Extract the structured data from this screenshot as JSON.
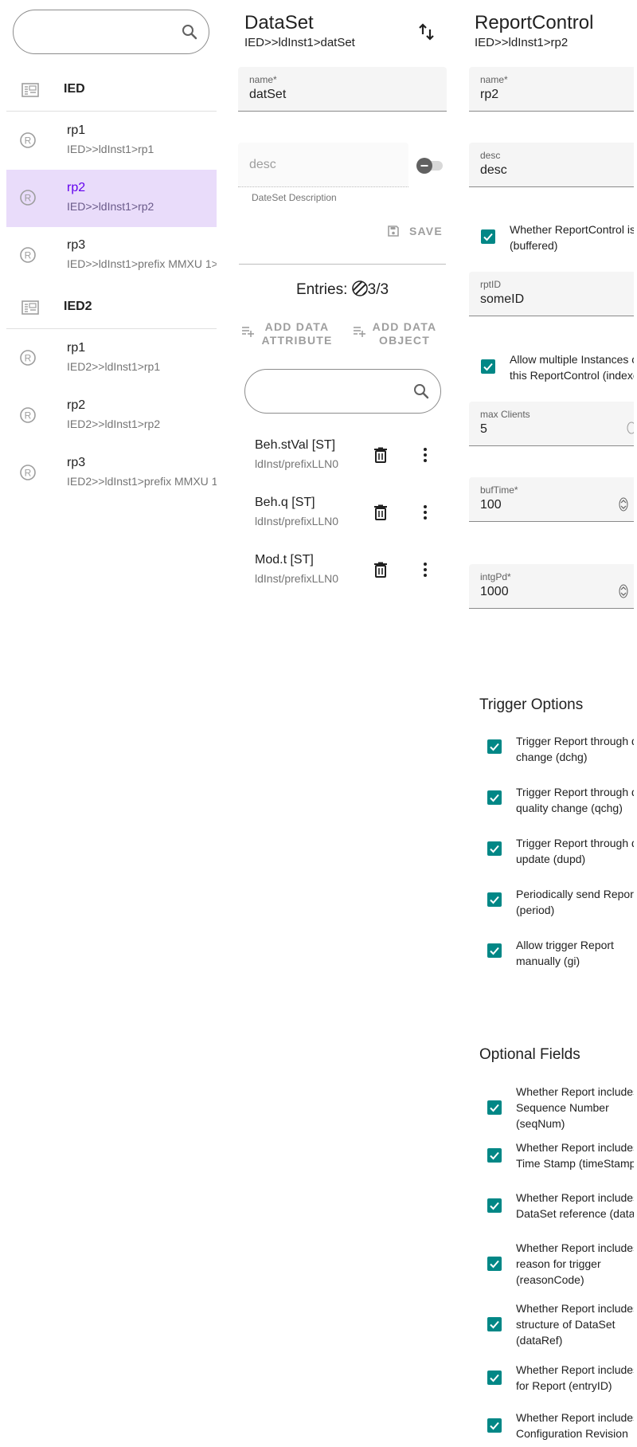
{
  "sidebar": {
    "search": {
      "placeholder": ""
    },
    "ieds": [
      {
        "name": "IED",
        "reports": [
          {
            "title": "rp1",
            "path": "IED>>ldInst1>rp1"
          },
          {
            "title": "rp2",
            "path": "IED>>ldInst1>rp2",
            "selected": true
          },
          {
            "title": "rp3",
            "path": "IED>>ldInst1>prefix MMXU 1>"
          }
        ]
      },
      {
        "name": "IED2",
        "reports": [
          {
            "title": "rp1",
            "path": "IED2>>ldInst1>rp1"
          },
          {
            "title": "rp2",
            "path": "IED2>>ldInst1>rp2"
          },
          {
            "title": "rp3",
            "path": "IED2>>ldInst1>prefix MMXU 1"
          }
        ]
      }
    ]
  },
  "dataset": {
    "title": "DataSet",
    "path": "IED>>ldInst1>datSet",
    "name_label": "name*",
    "name_value": "datSet",
    "desc_placeholder": "desc",
    "desc_helper": "DateSet Description",
    "save_label": "SAVE",
    "entries_label": "Entries:",
    "entries_count": "3/3",
    "add_attribute_label": "ADD DATA ATTRIBUTE",
    "add_object_label": "ADD DATA OBJECT",
    "filter_placeholder": "",
    "entries": [
      {
        "title": "Beh.stVal [ST]",
        "path": "ldInst/prefixLLN0"
      },
      {
        "title": "Beh.q [ST]",
        "path": "ldInst/prefixLLN0"
      },
      {
        "title": "Mod.t [ST]",
        "path": "ldInst/prefixLLN0"
      }
    ]
  },
  "report": {
    "title": "ReportControl",
    "path": "IED>>ldInst1>rp2",
    "fields": {
      "name": {
        "label": "name*",
        "value": "rp2"
      },
      "desc": {
        "label": "desc",
        "value": "desc"
      },
      "buffered": {
        "label": "Whether ReportControl is (buffered)",
        "checked": true
      },
      "rptID": {
        "label": "rptID",
        "value": "someID"
      },
      "indexed": {
        "label": "Allow multiple Instances of this ReportControl (indexed)",
        "checked": true
      },
      "maxClients": {
        "label": "max Clients",
        "value": "5"
      },
      "bufTime": {
        "label": "bufTime*",
        "value": "100"
      },
      "intgPd": {
        "label": "intgPd*",
        "value": "1000"
      }
    },
    "trigger_title": "Trigger Options",
    "triggers": [
      {
        "line1": "Trigger Report through data",
        "line2": "change (dchg)",
        "checked": true
      },
      {
        "line1": "Trigger Report through data",
        "line2": "quality change (qchg)",
        "checked": true
      },
      {
        "line1": "Trigger Report through data",
        "line2": "update (dupd)",
        "checked": true
      },
      {
        "line1": "Periodically send Report",
        "line2": "(period)",
        "checked": true
      },
      {
        "line1": "Allow trigger Report",
        "line2": "manually (gi)",
        "checked": true
      }
    ],
    "optional_title": "Optional Fields",
    "optional": [
      {
        "line1": "Whether Report includes",
        "line2": "Sequence Number",
        "line3": "(seqNum)",
        "checked": true
      },
      {
        "line1": "Whether Report includes",
        "line2": "Time Stamp (timeStamp)",
        "line3": "",
        "checked": true
      },
      {
        "line1": "Whether Report includes",
        "line2": "DataSet reference (dataSet)",
        "line3": "",
        "checked": true
      },
      {
        "line1": "Whether Report includes",
        "line2": "reason for trigger",
        "line3": "(reasonCode)",
        "checked": true
      },
      {
        "line1": "Whether Report includes",
        "line2": "structure of DataSet",
        "line3": "(dataRef)",
        "checked": true
      },
      {
        "line1": "Whether Report includes",
        "line2": "for Report (entryID)",
        "line3": "",
        "checked": true
      },
      {
        "line1": "Whether Report includes",
        "line2": "Configuration Revision",
        "line3": "",
        "checked": true
      }
    ]
  },
  "colors": {
    "accent": "#018786",
    "selected_bg": "#e9dcfa",
    "selected_text": "#6200ee"
  }
}
